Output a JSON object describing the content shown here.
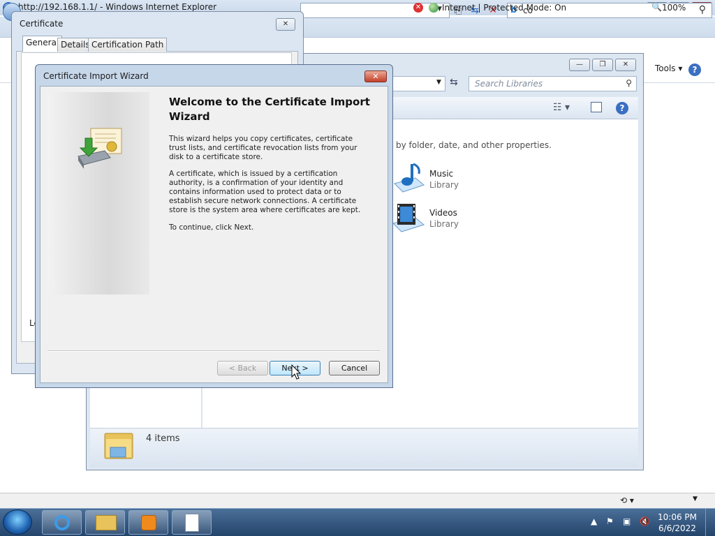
{
  "ie": {
    "title": "http://192.168.1.1/ - Windows Internet Explorer",
    "search_value": "co",
    "tools_label": "Tools ▾",
    "status_text": "Internet | Protected Mode: On",
    "zoom": "100%"
  },
  "explorer": {
    "search_placeholder": "Search Libraries",
    "description": "by folder, date, and other properties.",
    "libraries": [
      {
        "name": "Music",
        "type": "Library"
      },
      {
        "name": "Videos",
        "type": "Library"
      }
    ],
    "items_count": "4 items"
  },
  "certificate": {
    "title": "Certificate",
    "tabs": [
      "General",
      "Details",
      "Certification Path"
    ],
    "partial_text": "Le"
  },
  "wizard": {
    "title": "Certificate Import Wizard",
    "heading": "Welcome to the Certificate Import Wizard",
    "para1": "This wizard helps you copy certificates, certificate trust lists, and certificate revocation lists from your disk to a certificate store.",
    "para2": "A certificate, which is issued by a certification authority, is a confirmation of your identity and contains information used to protect data or to establish secure network connections. A certificate store is the system area where certificates are kept.",
    "para3": "To continue, click Next.",
    "back_label": "< Back",
    "next_label": "Next >",
    "cancel_label": "Cancel"
  },
  "taskbar": {
    "time": "10:06 PM",
    "date": "6/6/2022"
  }
}
